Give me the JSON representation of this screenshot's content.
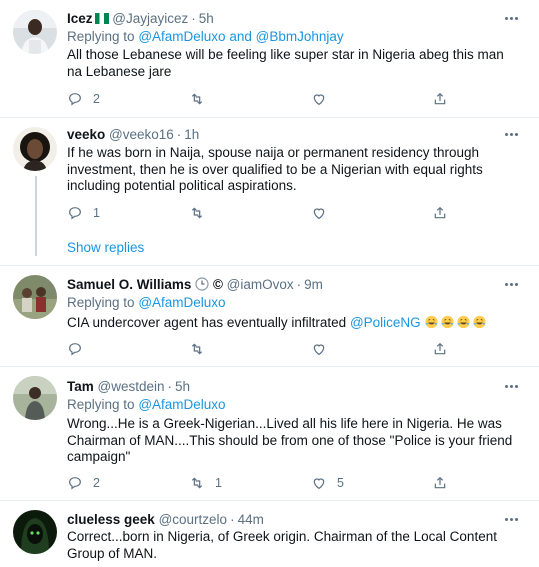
{
  "tweets": [
    {
      "name": "Icez",
      "flag": "🇳🇬",
      "handle": "@Jayjayicez",
      "time": "5h",
      "reply_prefix": "Replying to",
      "reply_to_1": "@AfamDeluxo",
      "reply_and": "and",
      "reply_to_2": "@BbmJohnjay",
      "text": "All those Lebanese will be feeling like super star in Nigeria abeg this man na Lebanese jare",
      "replies": "2",
      "retweets": "",
      "likes": ""
    },
    {
      "name": "veeko",
      "handle": "@veeko16",
      "time": "1h",
      "text": "If he was born in Naija,  spouse naija or permanent residency through investment, then he is over qualified to be a Nigerian with equal rights including potential political aspirations.",
      "replies": "1",
      "retweets": "",
      "likes": ""
    },
    {
      "name": "Samuel O. Williams",
      "badge": "©",
      "handle": "@iamOvox",
      "time": "9m",
      "reply_prefix": "Replying to",
      "reply_to_1": "@AfamDeluxo",
      "text_before": "CIA undercover agent has eventually infiltrated",
      "mention": "@PoliceNG",
      "replies": "",
      "retweets": "",
      "likes": ""
    },
    {
      "name": "Tam",
      "handle": "@westdein",
      "time": "5h",
      "reply_prefix": "Replying to",
      "reply_to_1": "@AfamDeluxo",
      "text": "Wrong...He is a Greek-Nigerian...Lived all his life here in Nigeria. He was Chairman of MAN....This should be from one of those \"Police is your friend campaign\"",
      "replies": "2",
      "retweets": "1",
      "likes": "5"
    },
    {
      "name": "clueless geek",
      "handle": "@courtzelo",
      "time": "44m",
      "text": "Correct...born in Nigeria, of Greek origin. Chairman of the Local Content Group of MAN."
    }
  ],
  "show_replies": "Show replies",
  "colors": {
    "link": "#1b95e0",
    "muted": "#5b7083",
    "divider": "#e6ecf0"
  },
  "icons": [
    "reply-icon",
    "retweet-icon",
    "like-icon",
    "share-icon",
    "more-icon",
    "clock-icon",
    "laughing-emoji"
  ]
}
